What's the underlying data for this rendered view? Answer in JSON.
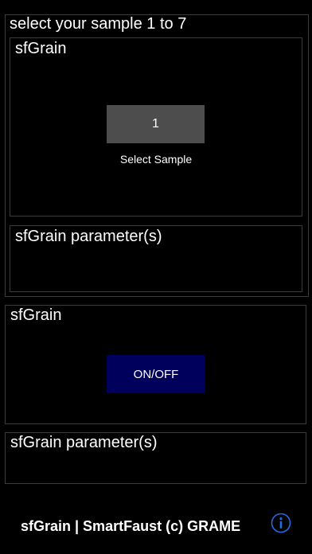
{
  "header": {
    "title": "select your sample 1 to 7"
  },
  "sample_group": {
    "title": "sfGrain",
    "value": "1",
    "caption": "Select Sample"
  },
  "params_group_1": {
    "title": "sfGrain parameter(s)"
  },
  "onoff_group": {
    "title": "sfGrain",
    "button_label": "ON/OFF"
  },
  "params_group_2": {
    "title": "sfGrain parameter(s)"
  },
  "footer": {
    "text": "sfGrain | SmartFaust (c) GRAME",
    "info_icon": "info-icon"
  },
  "colors": {
    "background": "#000000",
    "panel_border": "#3a3a3a",
    "value_box": "#4d4d4d",
    "onoff_button": "#00005c",
    "info_accent": "#1f6fe0"
  }
}
